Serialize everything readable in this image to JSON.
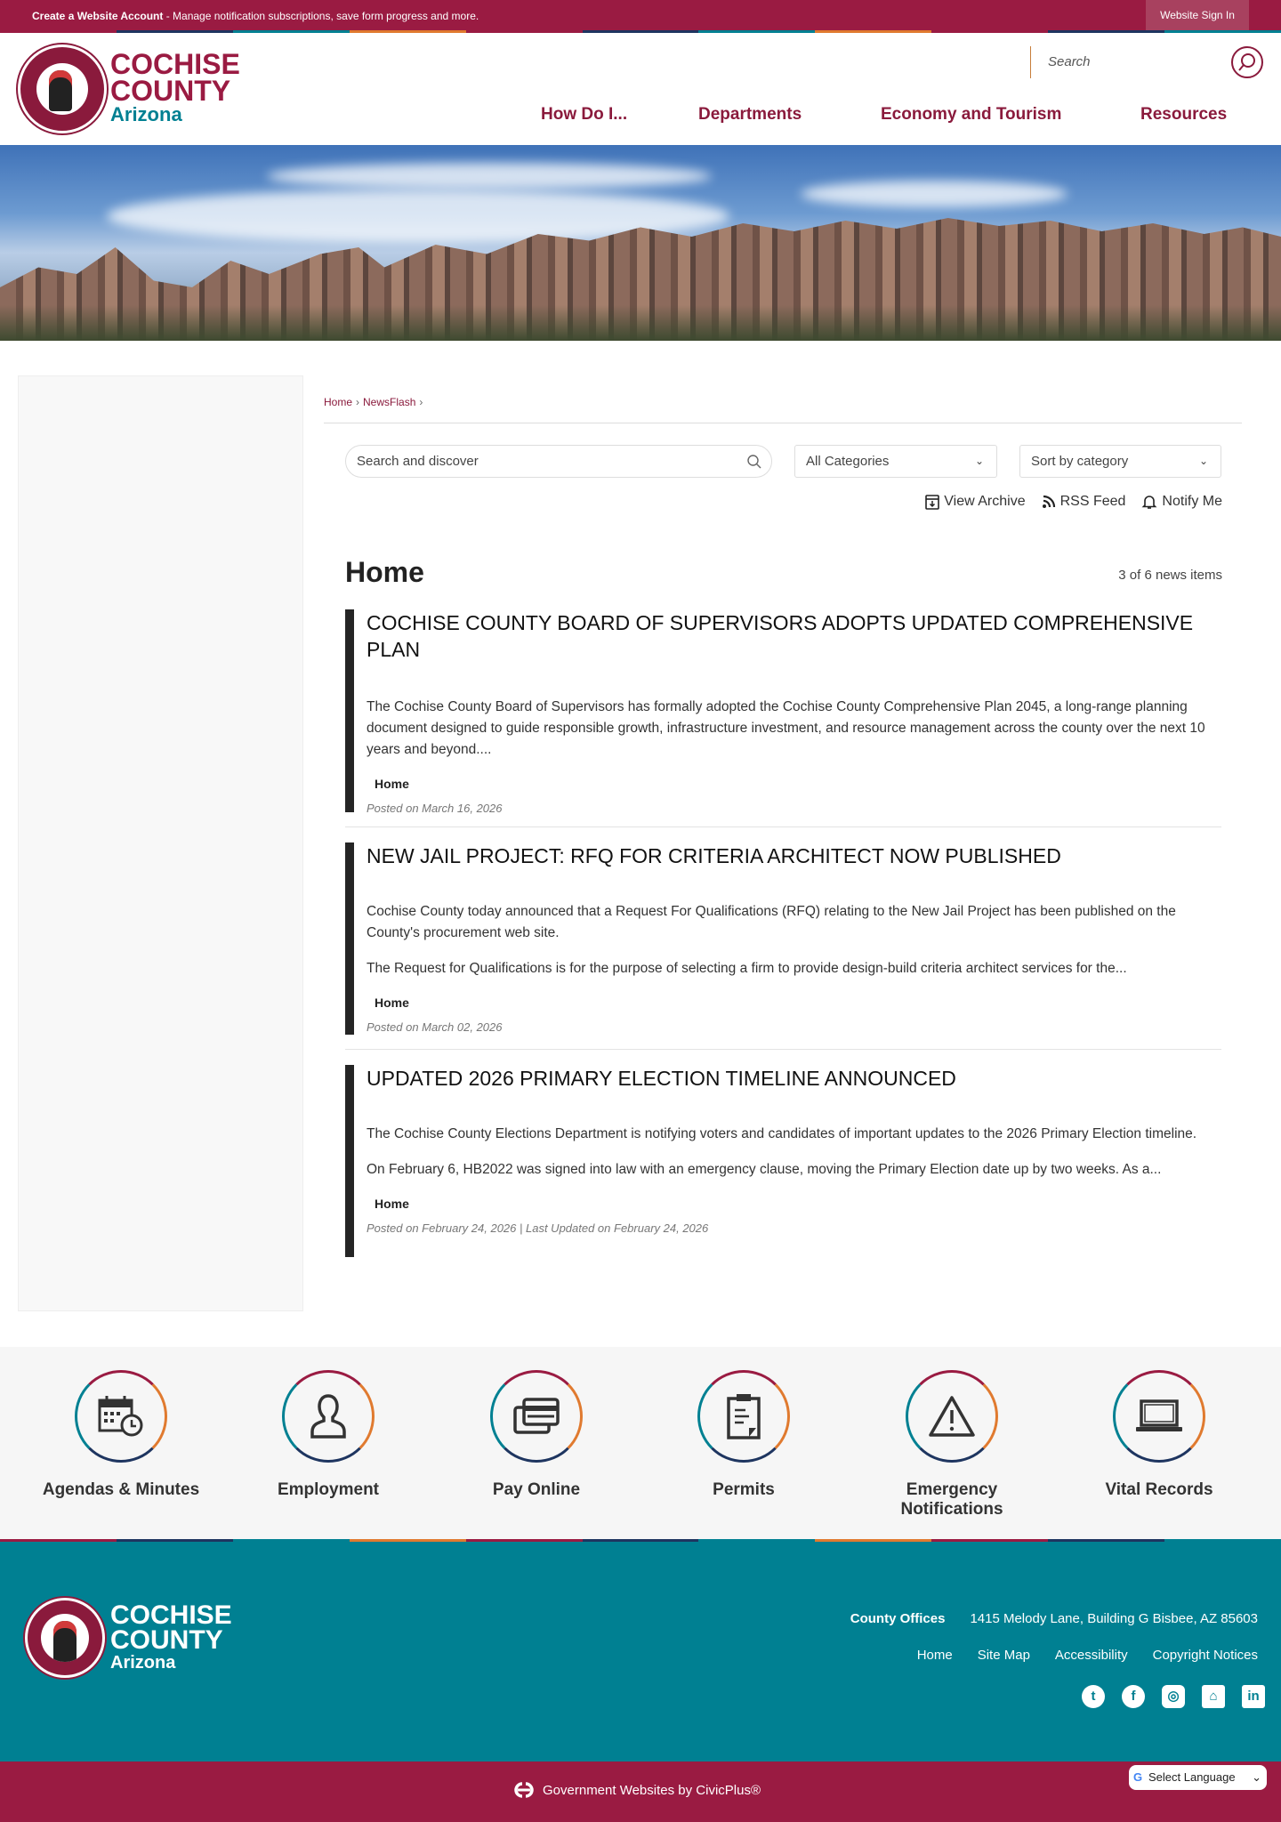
{
  "topbar": {
    "account_link": "Create a Website Account",
    "account_msg": " - Manage notification subscriptions, save form progress and more.",
    "sign_in": "Website Sign In"
  },
  "colors": {
    "maroon": "#9a1b42",
    "teal": "#008092",
    "navy": "#1e3560",
    "orange": "#e07a2f"
  },
  "logo": {
    "line1": "COCHISE",
    "line2": "COUNTY",
    "line3": "Arizona"
  },
  "header": {
    "search_placeholder": "Search",
    "nav": [
      "How Do I...",
      "Departments",
      "Economy and Tourism",
      "Resources"
    ]
  },
  "breadcrumb": [
    "Home",
    "NewsFlash"
  ],
  "filters": {
    "search_placeholder": "Search and discover",
    "category": "All Categories",
    "sort": "Sort by category"
  },
  "actions": {
    "archive": "View Archive",
    "rss": "RSS Feed",
    "notify": "Notify Me"
  },
  "main": {
    "title": "Home",
    "count": "3 of 6 news items"
  },
  "articles": [
    {
      "title": "COCHISE COUNTY BOARD OF SUPERVISORS ADOPTS UPDATED COMPREHENSIVE PLAN",
      "paras": [
        "The Cochise County Board of Supervisors has formally adopted the Cochise County Comprehensive Plan 2045, a long-range planning document designed to guide responsible growth, infrastructure investment, and resource management across the county over the next 10 years and beyond...."
      ],
      "category": "Home",
      "date": "Posted on March 16, 2026"
    },
    {
      "title": "NEW JAIL PROJECT: RFQ FOR CRITERIA ARCHITECT NOW PUBLISHED",
      "paras": [
        "Cochise County today announced that a Request For Qualifications (RFQ) relating to the New Jail Project has been published on the County's procurement web site.",
        "The Request for Qualifications is for the purpose of selecting a firm to provide design-build criteria architect services for the..."
      ],
      "category": "Home",
      "date": "Posted on March 02, 2026"
    },
    {
      "title": "UPDATED 2026 PRIMARY ELECTION TIMELINE ANNOUNCED",
      "paras": [
        "The Cochise County Elections Department is notifying voters and candidates of important updates to the 2026 Primary Election timeline.",
        "On February 6, HB2022 was signed into law with an emergency clause, moving the Primary Election date up by two weeks. As a..."
      ],
      "category": "Home",
      "date": "Posted on February 24, 2026 | Last Updated on February 24, 2026"
    }
  ],
  "quick_links": [
    {
      "label": "Agendas & Minutes",
      "icon": "calendar-clock-icon"
    },
    {
      "label": "Employment",
      "icon": "person-icon"
    },
    {
      "label": "Pay Online",
      "icon": "credit-card-icon"
    },
    {
      "label": "Permits",
      "icon": "clipboard-icon"
    },
    {
      "label": "Emergency Notifications",
      "icon": "warning-icon"
    },
    {
      "label": "Vital Records",
      "icon": "laptop-icon"
    }
  ],
  "footer": {
    "offices_label": "County Offices",
    "address": "1415 Melody Lane, Building G Bisbee, AZ 85603",
    "links": [
      "Home",
      "Site Map",
      "Accessibility",
      "Copyright Notices"
    ],
    "social": [
      "twitter",
      "facebook",
      "instagram",
      "nextdoor",
      "linkedin"
    ]
  },
  "bottom": {
    "credit": "Government Websites by CivicPlus®",
    "language": "Select Language"
  }
}
